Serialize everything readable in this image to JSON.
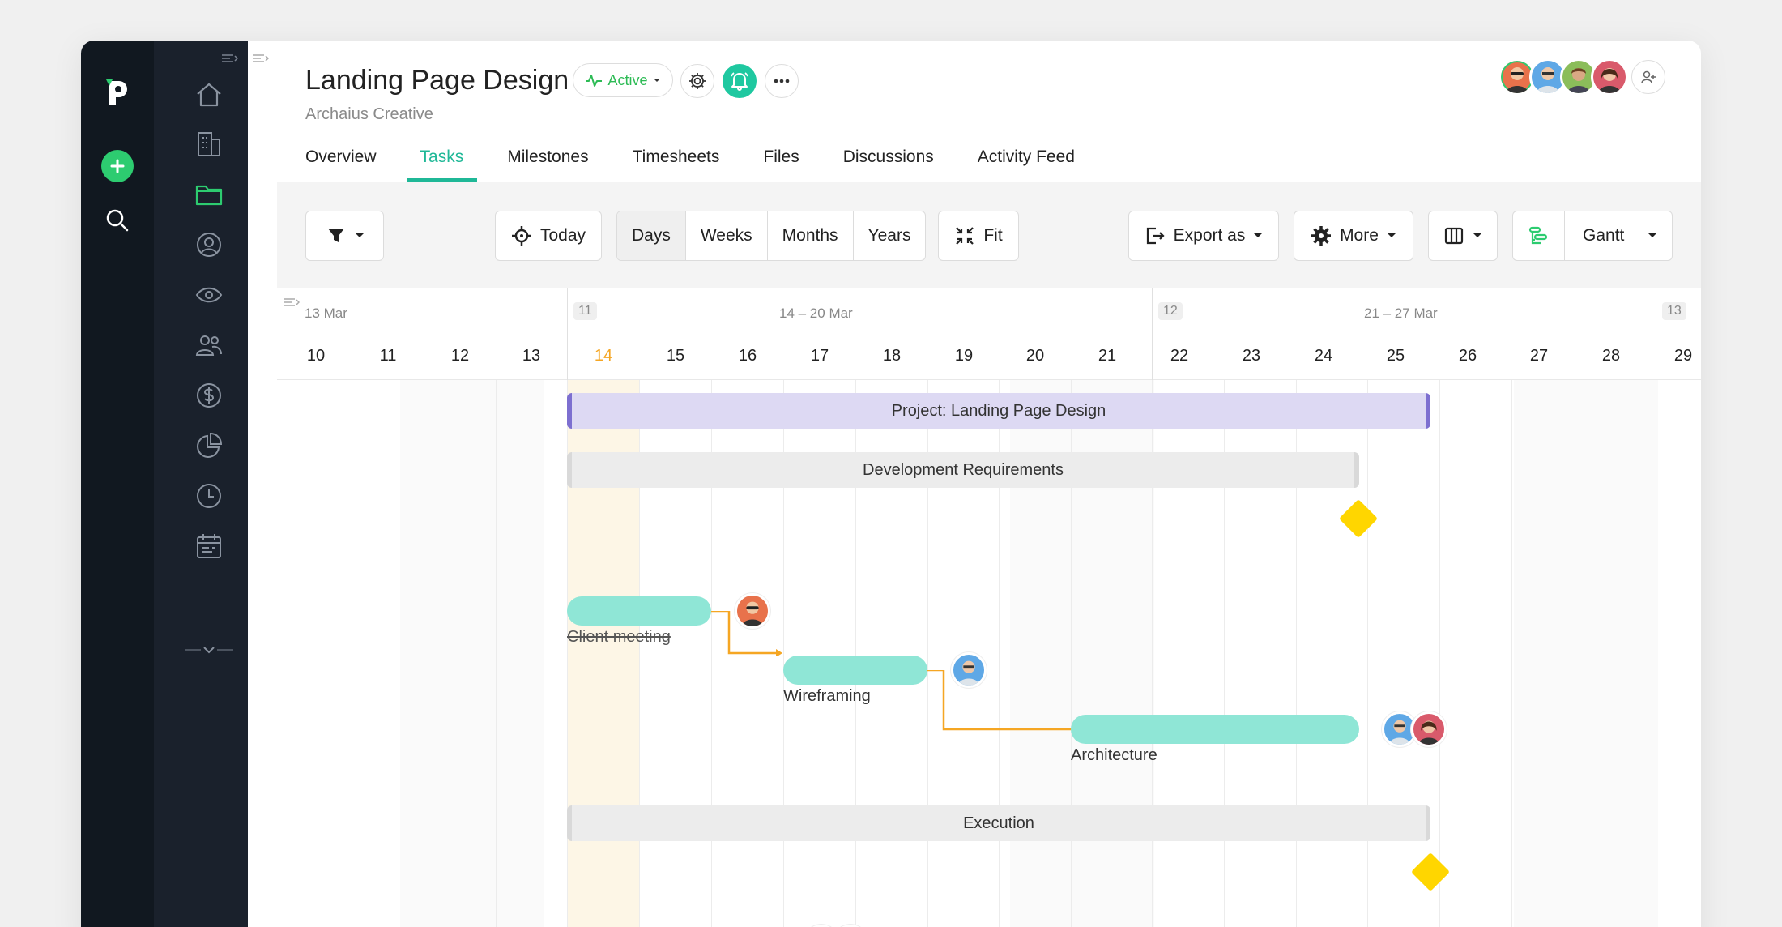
{
  "project": {
    "title": "Landing Page Design",
    "client": "Archaius Creative",
    "status": "Active"
  },
  "tabs": [
    {
      "label": "Overview"
    },
    {
      "label": "Tasks"
    },
    {
      "label": "Milestones"
    },
    {
      "label": "Timesheets"
    },
    {
      "label": "Files"
    },
    {
      "label": "Discussions"
    },
    {
      "label": "Activity Feed"
    }
  ],
  "toolbar": {
    "today": "Today",
    "scale": [
      "Days",
      "Weeks",
      "Months",
      "Years"
    ],
    "selected_scale": "Days",
    "fit": "Fit",
    "export": "Export as",
    "more": "More",
    "view": "Gantt"
  },
  "timeline": {
    "weeks": [
      {
        "num": "",
        "label": "13 Mar"
      },
      {
        "num": "11",
        "label": "14 – 20 Mar"
      },
      {
        "num": "12",
        "label": "21 – 27 Mar"
      },
      {
        "num": "13",
        "label": ""
      }
    ],
    "days": [
      "10",
      "11",
      "12",
      "13",
      "14",
      "15",
      "16",
      "17",
      "18",
      "19",
      "20",
      "21",
      "22",
      "23",
      "24",
      "25",
      "26",
      "27",
      "28",
      "29"
    ],
    "today": "14"
  },
  "gantt": {
    "project_bar": "Project: Landing Page Design",
    "groups": [
      "Development Requirements",
      "Execution"
    ],
    "tasks": [
      {
        "label": "Client meeting",
        "done": true
      },
      {
        "label": "Wireframing",
        "done": false
      },
      {
        "label": "Architecture",
        "done": false
      }
    ]
  },
  "colors": {
    "accent": "#1fb897",
    "brand_green": "#2dcc70",
    "milestone": "#ffd600",
    "task_bar": "#8fe6d6",
    "project_bar": "#ddd9f3",
    "dependency": "#f5a623"
  }
}
